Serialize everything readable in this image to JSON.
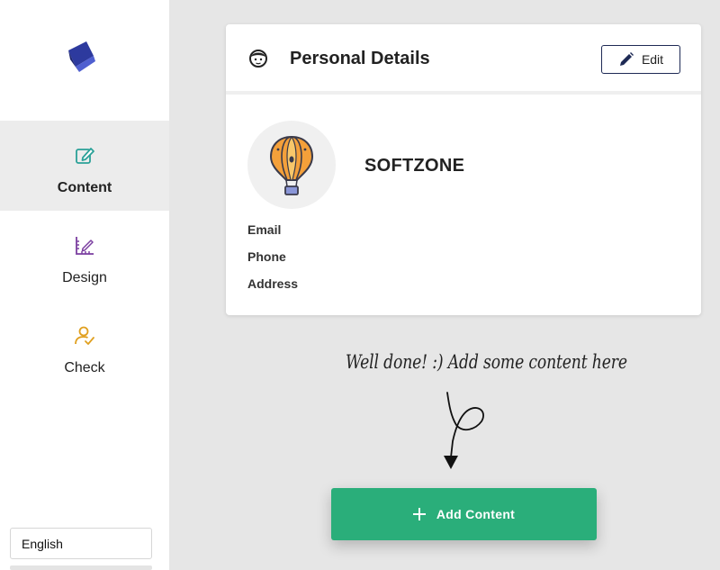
{
  "sidebar": {
    "logo": "app-logo",
    "items": [
      {
        "label": "Content",
        "icon": "edit-square-icon",
        "color": "#2aa198",
        "active": true
      },
      {
        "label": "Design",
        "icon": "ruler-pencil-icon",
        "color": "#7b3fa0",
        "active": false
      },
      {
        "label": "Check",
        "icon": "user-check-icon",
        "color": "#e0a020",
        "active": false
      }
    ],
    "language": "English"
  },
  "card": {
    "title": "Personal Details",
    "edit_label": "Edit",
    "name": "SOFTZONE",
    "fields": {
      "email": "Email",
      "phone": "Phone",
      "address": "Address"
    }
  },
  "hint": "Well done! :) Add some content here",
  "add_button": "Add Content",
  "colors": {
    "accent": "#2aae7a",
    "edit_border": "#1e2a55",
    "logo": "#2d3a9e"
  }
}
